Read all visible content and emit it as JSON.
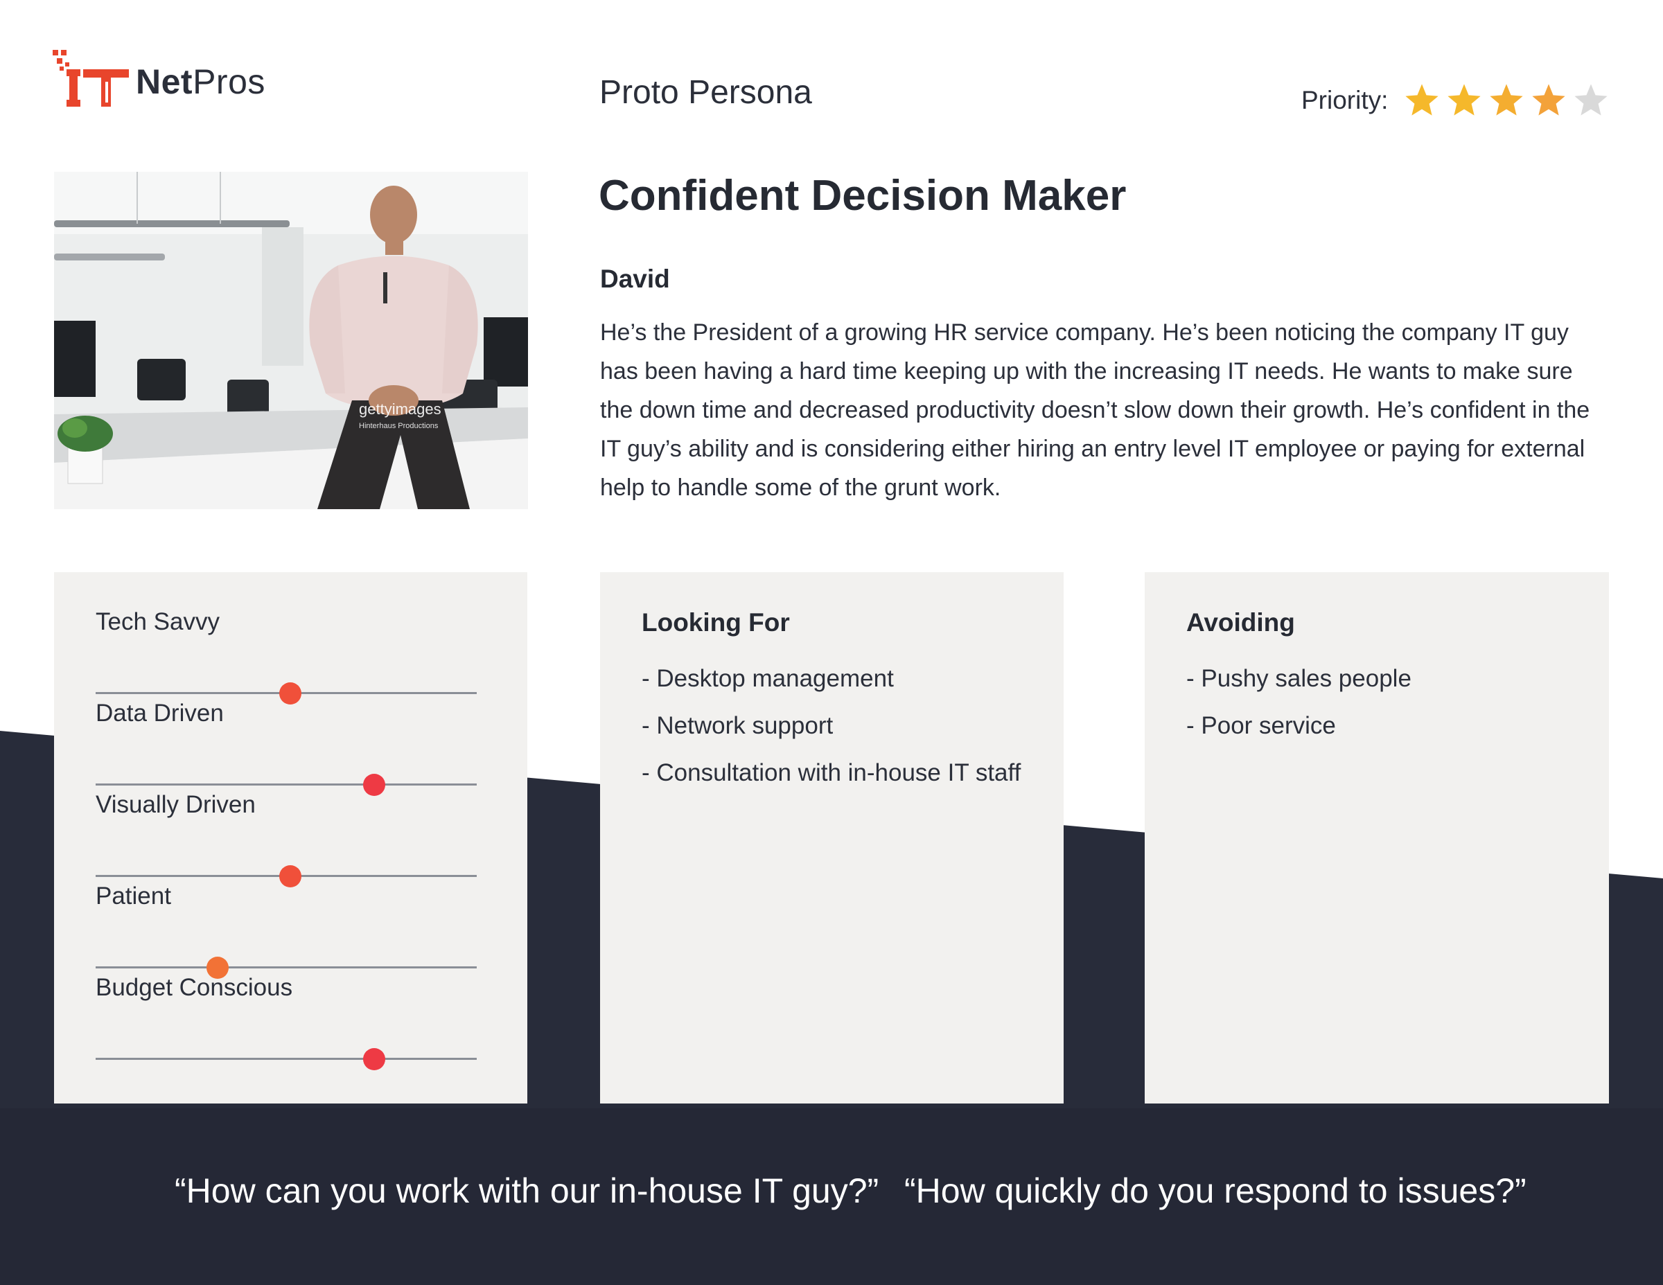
{
  "brand": {
    "name_bold": "Net",
    "name_regular": "Pros",
    "logo_icon": "it-logo-icon",
    "accent_color": "#e8452c"
  },
  "header": {
    "doc_type": "Proto Persona",
    "priority_label": "Priority:",
    "priority_rating": 4,
    "priority_max": 5
  },
  "photo": {
    "watermark_brand": "gettyimages",
    "watermark_credit": "Hinterhaus Productions"
  },
  "persona": {
    "title": "Confident Decision Maker",
    "name": "David",
    "bio": "He’s the President of a growing HR service company. He’s been noticing the company IT guy has been having a hard time keeping up with the increasing IT needs. He wants to make sure the down time and decreased productivity doesn’t slow down their growth. He’s confident in the IT guy’s ability and is considering either hiring an entry level IT employee or paying for external help to handle some of the grunt work."
  },
  "traits": [
    {
      "label": "Tech Savvy",
      "level": 0.51,
      "color": "#f0503a"
    },
    {
      "label": "Data Driven",
      "level": 0.73,
      "color": "#ee3a44"
    },
    {
      "label": "Visually Driven",
      "level": 0.51,
      "color": "#f0503a"
    },
    {
      "label": "Patient",
      "level": 0.32,
      "color": "#f27236"
    },
    {
      "label": "Budget Conscious",
      "level": 0.73,
      "color": "#ee3a44"
    }
  ],
  "looking_for": {
    "heading": "Looking For",
    "items": [
      "- Desktop management",
      "- Network support",
      "- Consultation with in-house IT staff"
    ]
  },
  "avoiding": {
    "heading": "Avoiding",
    "items": [
      "- Pushy sales people",
      "- Poor service"
    ]
  },
  "quotes": [
    "“How can you work with our in-house IT guy?”",
    "“How quickly do you respond to issues?”"
  ],
  "colors": {
    "band": "#282c3a",
    "card": "#f2f1ef",
    "star_filled": "#f5b82b",
    "star_filled_last": "#f3a23a",
    "star_empty": "#d9d9d9"
  }
}
